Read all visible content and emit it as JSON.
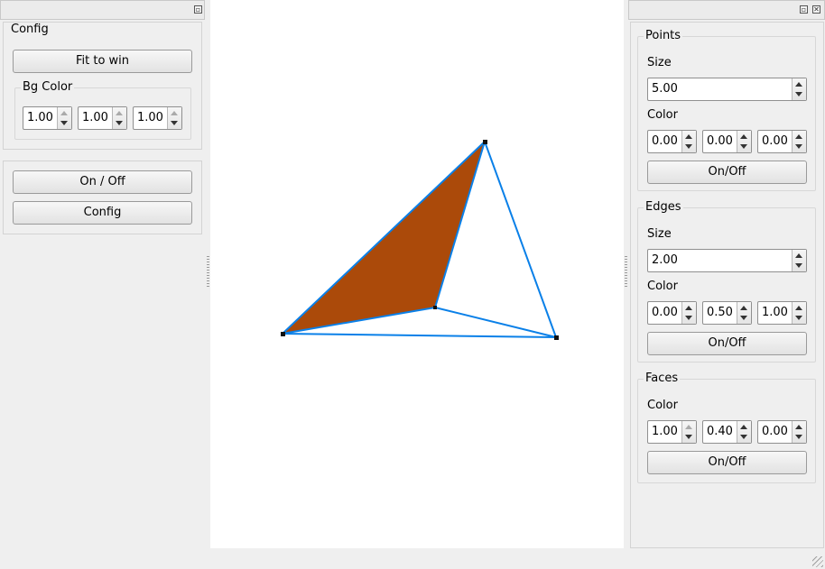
{
  "left_dock": {
    "config_group": {
      "title": "Config",
      "fit_button": "Fit to win",
      "bg_color": {
        "title": "Bg Color",
        "values": [
          "1.00",
          "1.00",
          "1.00"
        ]
      }
    },
    "on_off_button": "On / Off",
    "config_button": "Config"
  },
  "right_dock": {
    "points": {
      "title": "Points",
      "size_label": "Size",
      "size": "5.00",
      "color_label": "Color",
      "color": [
        "0.00",
        "0.00",
        "0.00"
      ],
      "toggle": "On/Off"
    },
    "edges": {
      "title": "Edges",
      "size_label": "Size",
      "size": "2.00",
      "color_label": "Color",
      "color": [
        "0.00",
        "0.50",
        "1.00"
      ],
      "toggle": "On/Off"
    },
    "faces": {
      "title": "Faces",
      "color_label": "Color",
      "color": [
        "1.00",
        "0.40",
        "0.00"
      ],
      "toggle": "On/Off"
    }
  },
  "viewport": {
    "background": "#ffffff",
    "face_color": "#ab4a0a",
    "edge_color": "#0080ff",
    "point_color": "#000000"
  }
}
